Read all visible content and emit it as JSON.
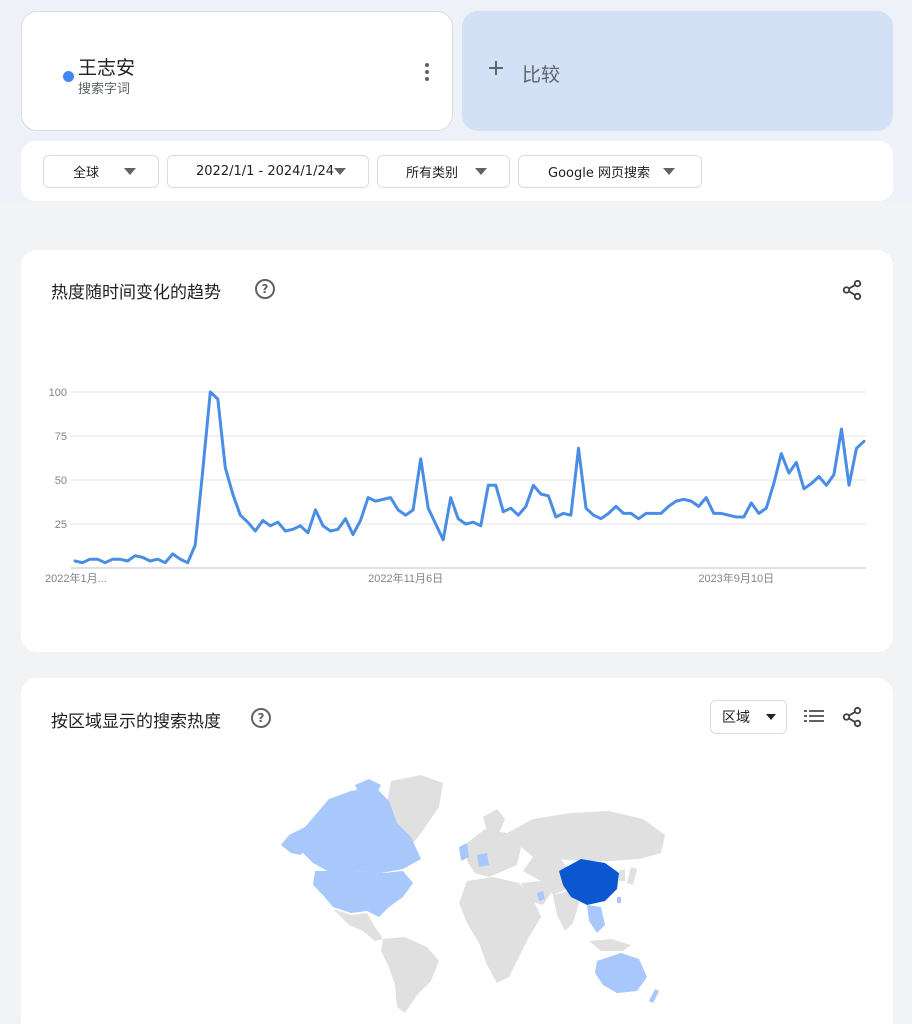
{
  "term": {
    "name": "王志安",
    "type": "搜索字词",
    "color": "#4285f4"
  },
  "compare": {
    "label": "比较"
  },
  "filters": [
    {
      "label": "全球"
    },
    {
      "label": "2022/1/1 - 2024/1/24"
    },
    {
      "label": "所有类别"
    },
    {
      "label": "Google 网页搜索"
    }
  ],
  "trend": {
    "title": "热度随时间变化的趋势",
    "help": "?"
  },
  "region": {
    "title": "按区域显示的搜索热度",
    "select_label": "区域",
    "help": "?"
  },
  "icons": {
    "share": "share-icon",
    "help": "help-circle-icon",
    "list": "list-icon",
    "more": "more-vert-icon"
  },
  "colors": {
    "accent": "#4285f4",
    "line": "#4a8de4",
    "map_high": "#0b57d0",
    "map_low": "#a8c7fa",
    "map_none": "#e0e0e0"
  },
  "chart_data": {
    "type": "line",
    "yticks": [
      100,
      75,
      50,
      25
    ],
    "ylim": [
      0,
      100
    ],
    "xtick_labels": [
      "2022年1月...",
      "2022年11月6日",
      "2023年9月10日"
    ],
    "xtick_index": [
      0,
      44,
      88
    ],
    "series": [
      {
        "values": [
          4,
          3,
          5,
          5,
          3,
          5,
          5,
          4,
          7,
          6,
          4,
          5,
          3,
          8,
          5,
          3,
          13,
          55,
          100,
          96,
          57,
          42,
          30,
          26,
          21,
          27,
          24,
          26,
          21,
          22,
          24,
          20,
          33,
          24,
          21,
          22,
          28,
          19,
          27,
          40,
          38,
          39,
          40,
          33,
          30,
          33,
          62,
          34,
          25,
          16,
          40,
          28,
          25,
          26,
          24,
          47,
          47,
          32,
          34,
          30,
          35,
          47,
          42,
          41,
          29,
          31,
          30,
          68,
          34,
          30,
          28,
          31,
          35,
          31,
          31,
          28,
          31,
          31,
          31,
          35,
          38,
          39,
          38,
          35,
          40,
          31,
          31,
          30,
          29,
          29,
          37,
          31,
          34,
          48,
          65,
          54,
          60,
          45,
          48,
          52,
          47,
          53,
          79,
          47,
          68,
          72
        ]
      }
    ]
  }
}
